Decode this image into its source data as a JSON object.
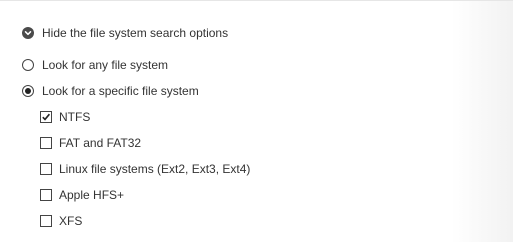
{
  "toggle": {
    "label": "Hide the file system search options",
    "icon": "chevron-down-icon"
  },
  "search_mode": {
    "options": [
      {
        "label": "Look for any file system",
        "selected": false
      },
      {
        "label": "Look for a specific file system",
        "selected": true
      }
    ]
  },
  "file_systems": [
    {
      "label": "NTFS",
      "checked": true
    },
    {
      "label": "FAT and FAT32",
      "checked": false
    },
    {
      "label": "Linux file systems (Ext2, Ext3, Ext4)",
      "checked": false
    },
    {
      "label": "Apple HFS+",
      "checked": false
    },
    {
      "label": "XFS",
      "checked": false
    }
  ],
  "colors": {
    "text": "#333333",
    "toggle_icon_bg": "#4a4a4a"
  }
}
